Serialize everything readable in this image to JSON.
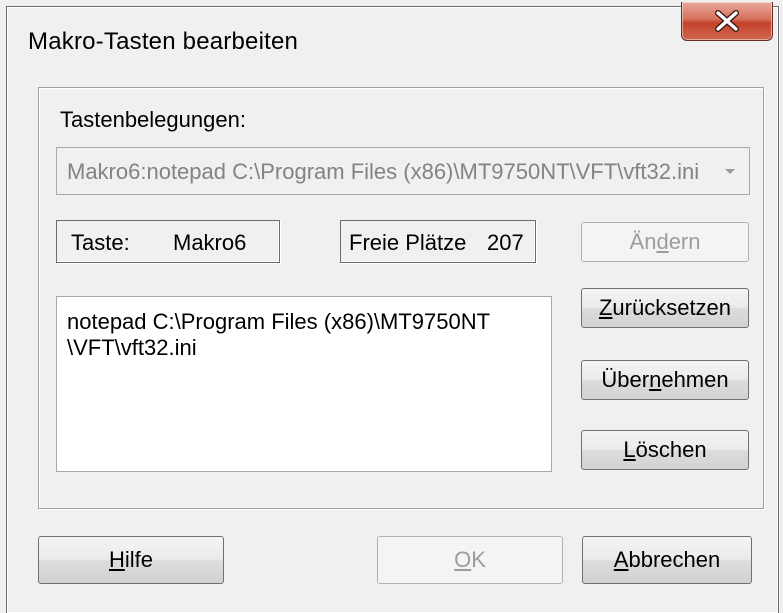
{
  "window": {
    "title": "Makro-Tasten bearbeiten"
  },
  "group": {
    "label": "Tastenbelegungen:"
  },
  "combo": {
    "selected": "Makro6:notepad C:\\Program Files (x86)\\MT9750NT\\VFT\\vft32.ini"
  },
  "taste": {
    "label": "Taste:",
    "value": "Makro6"
  },
  "freie": {
    "label": "Freie Plätze",
    "value": "207"
  },
  "buttons": {
    "aendern": {
      "pre": "Än",
      "u": "d",
      "post": "ern"
    },
    "zuruecksetzen": {
      "pre": "",
      "u": "Z",
      "post": "urücksetzen"
    },
    "uebernehmen": {
      "pre": "Über",
      "u": "n",
      "post": "ehmen"
    },
    "loeschen": {
      "pre": "",
      "u": "L",
      "post": "öschen"
    },
    "hilfe": {
      "pre": "",
      "u": "H",
      "post": "ilfe"
    },
    "ok": {
      "pre": "",
      "u": "O",
      "post": "K"
    },
    "abbrechen": {
      "pre": "",
      "u": "A",
      "post": "bbrechen"
    }
  },
  "memo": {
    "text": "notepad C:\\Program Files (x86)\\MT9750NT\n\\VFT\\vft32.ini"
  },
  "icons": {
    "close": "close-icon",
    "dropdown": "chevron-down-icon"
  }
}
